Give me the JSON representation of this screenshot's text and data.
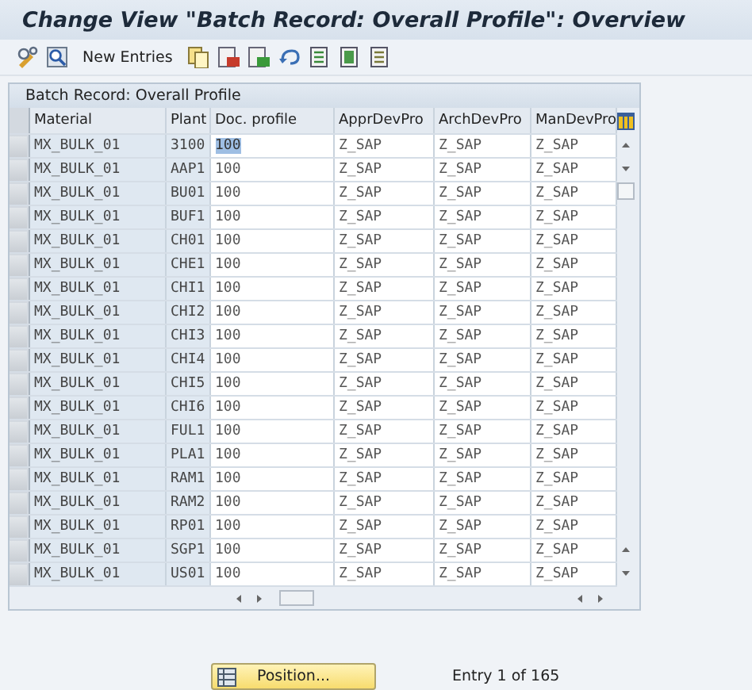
{
  "window": {
    "title": "Change View \"Batch Record: Overall Profile\": Overview"
  },
  "toolbar": {
    "new_entries_label": "New Entries"
  },
  "table": {
    "title": "Batch Record: Overall Profile",
    "columns": [
      "Material",
      "Plant",
      "Doc. profile",
      "ApprDevPro",
      "ArchDevPro",
      "ManDevPro"
    ],
    "rows": [
      {
        "cells": [
          "MX_BULK_01",
          "3100",
          "100",
          "Z_SAP",
          "Z_SAP",
          "Z_SAP"
        ],
        "text_selected": true
      },
      {
        "cells": [
          "MX_BULK_01",
          "AAP1",
          "100",
          "Z_SAP",
          "Z_SAP",
          "Z_SAP"
        ],
        "text_selected": false
      },
      {
        "cells": [
          "MX_BULK_01",
          "BU01",
          "100",
          "Z_SAP",
          "Z_SAP",
          "Z_SAP"
        ],
        "text_selected": false
      },
      {
        "cells": [
          "MX_BULK_01",
          "BUF1",
          "100",
          "Z_SAP",
          "Z_SAP",
          "Z_SAP"
        ],
        "text_selected": false
      },
      {
        "cells": [
          "MX_BULK_01",
          "CH01",
          "100",
          "Z_SAP",
          "Z_SAP",
          "Z_SAP"
        ],
        "text_selected": false
      },
      {
        "cells": [
          "MX_BULK_01",
          "CHE1",
          "100",
          "Z_SAP",
          "Z_SAP",
          "Z_SAP"
        ],
        "text_selected": false
      },
      {
        "cells": [
          "MX_BULK_01",
          "CHI1",
          "100",
          "Z_SAP",
          "Z_SAP",
          "Z_SAP"
        ],
        "text_selected": false
      },
      {
        "cells": [
          "MX_BULK_01",
          "CHI2",
          "100",
          "Z_SAP",
          "Z_SAP",
          "Z_SAP"
        ],
        "text_selected": false
      },
      {
        "cells": [
          "MX_BULK_01",
          "CHI3",
          "100",
          "Z_SAP",
          "Z_SAP",
          "Z_SAP"
        ],
        "text_selected": false
      },
      {
        "cells": [
          "MX_BULK_01",
          "CHI4",
          "100",
          "Z_SAP",
          "Z_SAP",
          "Z_SAP"
        ],
        "text_selected": false
      },
      {
        "cells": [
          "MX_BULK_01",
          "CHI5",
          "100",
          "Z_SAP",
          "Z_SAP",
          "Z_SAP"
        ],
        "text_selected": false
      },
      {
        "cells": [
          "MX_BULK_01",
          "CHI6",
          "100",
          "Z_SAP",
          "Z_SAP",
          "Z_SAP"
        ],
        "text_selected": false
      },
      {
        "cells": [
          "MX_BULK_01",
          "FUL1",
          "100",
          "Z_SAP",
          "Z_SAP",
          "Z_SAP"
        ],
        "text_selected": false
      },
      {
        "cells": [
          "MX_BULK_01",
          "PLA1",
          "100",
          "Z_SAP",
          "Z_SAP",
          "Z_SAP"
        ],
        "text_selected": false
      },
      {
        "cells": [
          "MX_BULK_01",
          "RAM1",
          "100",
          "Z_SAP",
          "Z_SAP",
          "Z_SAP"
        ],
        "text_selected": false
      },
      {
        "cells": [
          "MX_BULK_01",
          "RAM2",
          "100",
          "Z_SAP",
          "Z_SAP",
          "Z_SAP"
        ],
        "text_selected": false
      },
      {
        "cells": [
          "MX_BULK_01",
          "RP01",
          "100",
          "Z_SAP",
          "Z_SAP",
          "Z_SAP"
        ],
        "text_selected": false
      },
      {
        "cells": [
          "MX_BULK_01",
          "SGP1",
          "100",
          "Z_SAP",
          "Z_SAP",
          "Z_SAP"
        ],
        "text_selected": false
      },
      {
        "cells": [
          "MX_BULK_01",
          "US01",
          "100",
          "Z_SAP",
          "Z_SAP",
          "Z_SAP"
        ],
        "text_selected": false
      }
    ]
  },
  "footer": {
    "position_button": "Position...",
    "entry_info": "Entry 1 of 165"
  }
}
